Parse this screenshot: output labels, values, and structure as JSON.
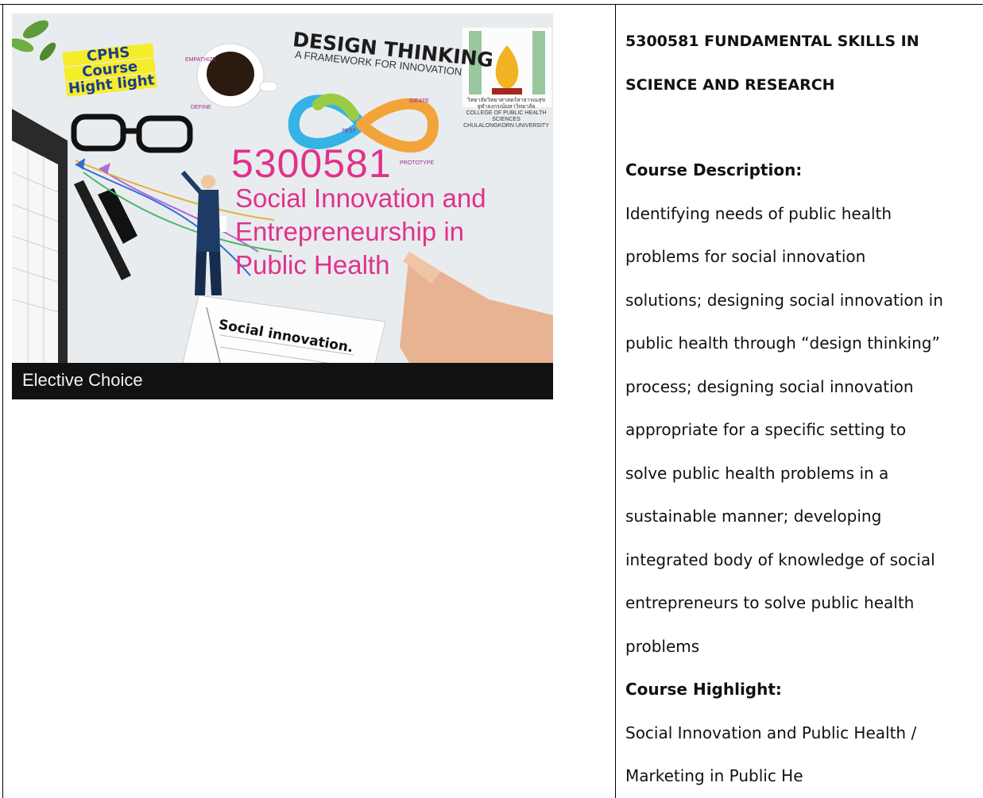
{
  "banner": {
    "badge_lines": [
      "CPHS",
      "Course",
      "Hight light"
    ],
    "design_thinking": "DESIGN THINKING",
    "framework": "A FRAMEWORK FOR INNOVATION",
    "course_code": "5300581",
    "course_title_lines": [
      "Social Innovation and",
      "Entrepreneurship in",
      "Public Health"
    ],
    "note": "Social innovation.",
    "seal_lines": [
      "วิทยาลัยวิทยาศาสตร์สาธารณสุข",
      "จุฬาลงกรณ์มหาวิทยาลัย",
      "COLLEGE OF PUBLIC HEALTH SCIENCES",
      "CHULALONGKORN UNIVERSITY"
    ],
    "footer": "Elective Choice"
  },
  "info": {
    "course_header_line1": "5300581 FUNDAMENTAL SKILLS IN",
    "course_header_line2": "SCIENCE AND RESEARCH",
    "description_label": "Course Description:",
    "description_lines": [
      "Identifying needs of public health",
      "problems for social innovation",
      "solutions; designing social innovation in",
      "public health through “design thinking”",
      "process; designing social innovation",
      "appropriate for a specific setting to",
      "solve public health problems in a",
      "sustainable manner; developing",
      "integrated body of knowledge of social",
      "entrepreneurs to solve public health",
      "problems"
    ],
    "highlight_label": "Course Highlight:",
    "highlight_lines": [
      "Social Innovation and Public Health /",
      "Marketing in Public He"
    ]
  },
  "colors": {
    "accent_pink": "#e0328b",
    "badge_yellow": "#f5ec2a",
    "badge_blue": "#1a3d8f",
    "footer_bg": "#111111"
  }
}
